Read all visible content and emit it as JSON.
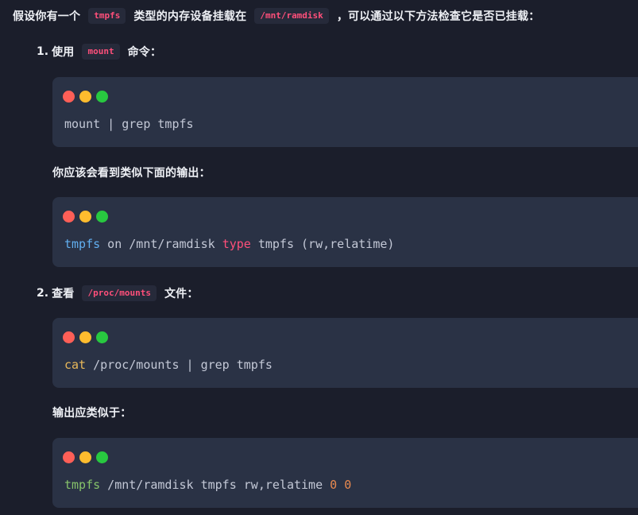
{
  "intro": {
    "before": "假设你有一个",
    "chip1": "tmpfs",
    "middle": "类型的内存设备挂载在",
    "chip2": "/mnt/ramdisk",
    "after": "，可以通过以下方法检查它是否已挂载："
  },
  "step1": {
    "number": "1.",
    "before": "使用",
    "chip": "mount",
    "after": "命令：",
    "code": "mount | grep tmpfs",
    "expected_label": "你应该会看到类似下面的输出：",
    "output": {
      "t1": "tmpfs",
      "t2": " on /mnt/ramdisk ",
      "t3": "type",
      "t4": " tmpfs (rw,relatime)"
    }
  },
  "step2": {
    "number": "2.",
    "before": "查看",
    "chip": "/proc/mounts",
    "after": "文件：",
    "code": {
      "t1": "cat",
      "t2": " /proc/mounts | grep tmpfs"
    },
    "expected_label": "输出应类似于：",
    "output": {
      "t1": "tmpfs",
      "t2": " /mnt/ramdisk tmpfs rw,relatime ",
      "t3": "0",
      "t4": " ",
      "t5": "0"
    }
  },
  "colors": {
    "background": "#1b1e2b",
    "code_block": "#2a3245",
    "chip_text": "#ff4f7a",
    "dot_red": "#fe5f57",
    "dot_yellow": "#febc2e",
    "dot_green": "#28c840"
  }
}
